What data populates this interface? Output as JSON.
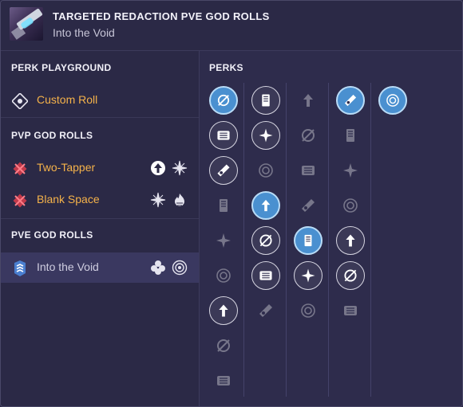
{
  "header": {
    "title": "TARGETED REDACTION PVE GOD ROLLS",
    "subtitle": "Into the Void",
    "weapon_icon": "weapon-thumbnail"
  },
  "sidebar": {
    "sections": [
      {
        "heading": "PERK PLAYGROUND",
        "items": [
          {
            "label": "Custom Roll",
            "icon": "custom-roll-icon"
          }
        ]
      },
      {
        "heading": "PVP GOD ROLLS",
        "items": [
          {
            "label": "Two-Tapper",
            "icon": "crossed-out-icon",
            "perks": [
              "rapid-hit-icon",
              "snap-icon"
            ]
          },
          {
            "label": "Blank Space",
            "icon": "crossed-out-icon",
            "perks": [
              "snap-icon",
              "flame-icon"
            ]
          }
        ]
      },
      {
        "heading": "PVE GOD ROLLS",
        "items": [
          {
            "label": "Into the Void",
            "icon": "chevron-rank-icon",
            "perks": [
              "cluster-icon",
              "target-icon"
            ],
            "selected": true
          }
        ]
      }
    ]
  },
  "perks_panel": {
    "heading": "PERKS",
    "selected_color": "#4a90d0",
    "columns": [
      {
        "name": "barrels",
        "perks": [
          {
            "icon": "barrel-spiral-icon",
            "state": "selected"
          },
          {
            "icon": "barrel-chamber-icon",
            "state": "active"
          },
          {
            "icon": "barrel-fluted-icon",
            "state": "active"
          },
          {
            "icon": "barrel-smallbore-icon",
            "state": "inactive"
          },
          {
            "icon": "barrel-hammer-icon",
            "state": "inactive"
          },
          {
            "icon": "barrel-corkscrew-icon",
            "state": "inactive"
          },
          {
            "icon": "barrel-arrowhead-icon",
            "state": "active"
          },
          {
            "icon": "barrel-extended-icon",
            "state": "inactive"
          },
          {
            "icon": "barrel-full-bore-icon",
            "state": "inactive"
          }
        ]
      },
      {
        "name": "magazines",
        "perks": [
          {
            "icon": "mag-ricochet-icon",
            "state": "active"
          },
          {
            "icon": "mag-appended-icon",
            "state": "active"
          },
          {
            "icon": "mag-flared-icon",
            "state": "inactive"
          },
          {
            "icon": "mag-tactical-icon",
            "state": "selected"
          },
          {
            "icon": "mag-armor-piercing-icon",
            "state": "active"
          },
          {
            "icon": "mag-extended-icon",
            "state": "active"
          },
          {
            "icon": "mag-steady-icon",
            "state": "inactive"
          }
        ]
      },
      {
        "name": "trait-one",
        "perks": [
          {
            "icon": "perk-threat-detector-icon",
            "state": "inactive"
          },
          {
            "icon": "perk-grave-robber-icon",
            "state": "inactive"
          },
          {
            "icon": "perk-mask-icon",
            "state": "inactive"
          },
          {
            "icon": "perk-feeding-frenzy-icon",
            "state": "inactive"
          },
          {
            "icon": "perk-cluster-icon",
            "state": "selected"
          },
          {
            "icon": "perk-sword-icon",
            "state": "active"
          },
          {
            "icon": "perk-snap-icon",
            "state": "inactive"
          }
        ]
      },
      {
        "name": "trait-two",
        "perks": [
          {
            "icon": "perk-target-icon",
            "state": "selected"
          },
          {
            "icon": "perk-shard-icon",
            "state": "inactive"
          },
          {
            "icon": "perk-flame-icon",
            "state": "inactive"
          },
          {
            "icon": "perk-flame-ring-icon",
            "state": "inactive"
          },
          {
            "icon": "perk-web-icon",
            "state": "active"
          },
          {
            "icon": "perk-arrow-up-icon",
            "state": "active"
          },
          {
            "icon": "perk-dotted-ring-icon",
            "state": "inactive"
          }
        ]
      },
      {
        "name": "masterwork",
        "perks": [
          {
            "icon": "masterwork-emblem-icon",
            "state": "selected"
          }
        ]
      }
    ]
  }
}
